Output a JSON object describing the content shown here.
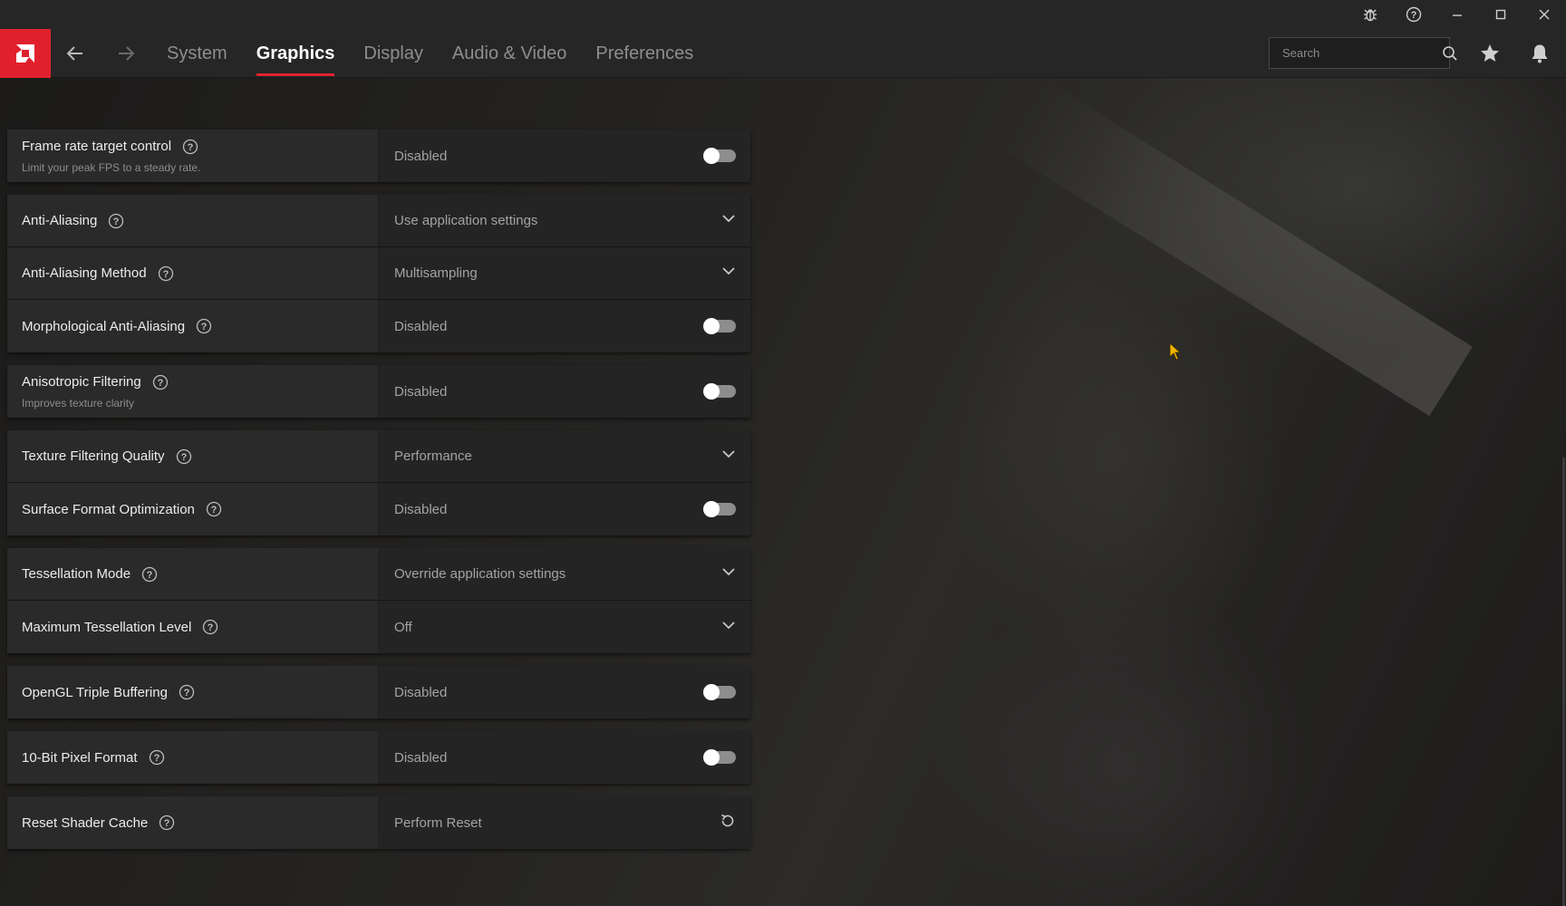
{
  "window": {
    "buttons": [
      {
        "name": "bug-report-icon"
      },
      {
        "name": "help-icon"
      },
      {
        "name": "minimize-icon"
      },
      {
        "name": "maximize-icon"
      },
      {
        "name": "close-icon"
      }
    ]
  },
  "nav": {
    "logo": "amd-logo-icon",
    "back_icon": "arrow-left-icon",
    "forward_icon": "arrow-right-icon",
    "tabs": [
      {
        "label": "System",
        "active": false
      },
      {
        "label": "Graphics",
        "active": true
      },
      {
        "label": "Display",
        "active": false
      },
      {
        "label": "Audio & Video",
        "active": false
      },
      {
        "label": "Preferences",
        "active": false
      }
    ],
    "search": {
      "placeholder": "Search",
      "value": ""
    },
    "favorites_icon": "star-icon",
    "notifications_icon": "bell-icon",
    "accent_color": "#e0212d"
  },
  "settings": {
    "groups": [
      {
        "rows": [
          {
            "label": "Frame rate target control",
            "sub": "Limit your peak FPS to a steady rate.",
            "value": "Disabled",
            "control": "toggle",
            "on": false
          }
        ]
      },
      {
        "rows": [
          {
            "label": "Anti-Aliasing",
            "value": "Use application settings",
            "control": "dropdown"
          },
          {
            "label": "Anti-Aliasing Method",
            "value": "Multisampling",
            "control": "dropdown"
          },
          {
            "label": "Morphological Anti-Aliasing",
            "value": "Disabled",
            "control": "toggle",
            "on": false
          }
        ]
      },
      {
        "rows": [
          {
            "label": "Anisotropic Filtering",
            "sub": "Improves texture clarity",
            "value": "Disabled",
            "control": "toggle",
            "on": false
          }
        ]
      },
      {
        "rows": [
          {
            "label": "Texture Filtering Quality",
            "value": "Performance",
            "control": "dropdown"
          },
          {
            "label": "Surface Format Optimization",
            "value": "Disabled",
            "control": "toggle",
            "on": false
          }
        ]
      },
      {
        "rows": [
          {
            "label": "Tessellation Mode",
            "value": "Override application settings",
            "control": "dropdown"
          },
          {
            "label": "Maximum Tessellation Level",
            "value": "Off",
            "control": "dropdown"
          }
        ]
      },
      {
        "rows": [
          {
            "label": "OpenGL Triple Buffering",
            "value": "Disabled",
            "control": "toggle",
            "on": false
          }
        ]
      },
      {
        "rows": [
          {
            "label": "10-Bit Pixel Format",
            "value": "Disabled",
            "control": "toggle",
            "on": false
          }
        ]
      },
      {
        "rows": [
          {
            "label": "Reset Shader Cache",
            "value": "Perform Reset",
            "control": "reset"
          }
        ]
      }
    ]
  }
}
